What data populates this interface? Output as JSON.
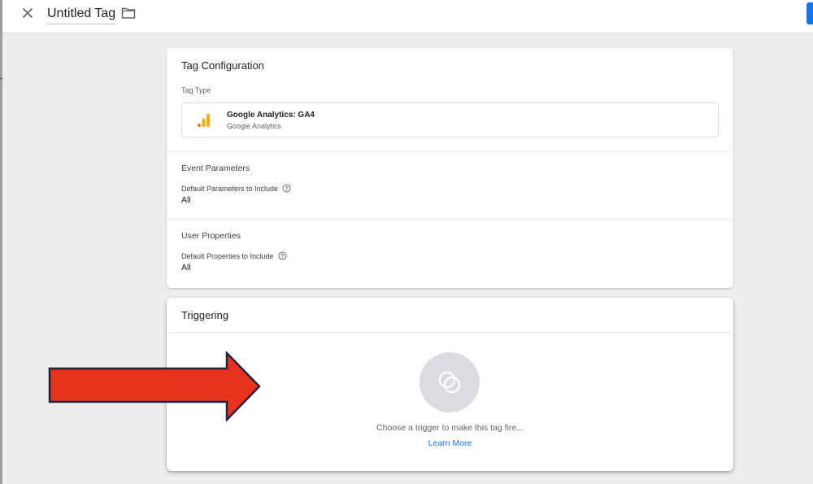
{
  "header": {
    "tag_name": "Untitled Tag"
  },
  "tag_configuration": {
    "title": "Tag Configuration",
    "tag_type_label": "Tag Type",
    "tag_type": {
      "name": "Google Analytics: GA4",
      "subtitle": "Google Analytics"
    },
    "event_parameters": {
      "title": "Event Parameters",
      "label": "Default Parameters to Include",
      "value": "All"
    },
    "user_properties": {
      "title": "User Properties",
      "label": "Default Properties to Include",
      "value": "All"
    }
  },
  "triggering": {
    "title": "Triggering",
    "message": "Choose a trigger to make this tag fire...",
    "learn_more": "Learn More"
  },
  "colors": {
    "accent": "#1a73e8",
    "annotation_arrow": "#e8321e",
    "ga_orange": "#f9ab00",
    "ga_dark_orange": "#e37400"
  },
  "icons": [
    "close-icon",
    "folder-icon",
    "google-analytics-icon",
    "help-icon",
    "trigger-icon"
  ]
}
